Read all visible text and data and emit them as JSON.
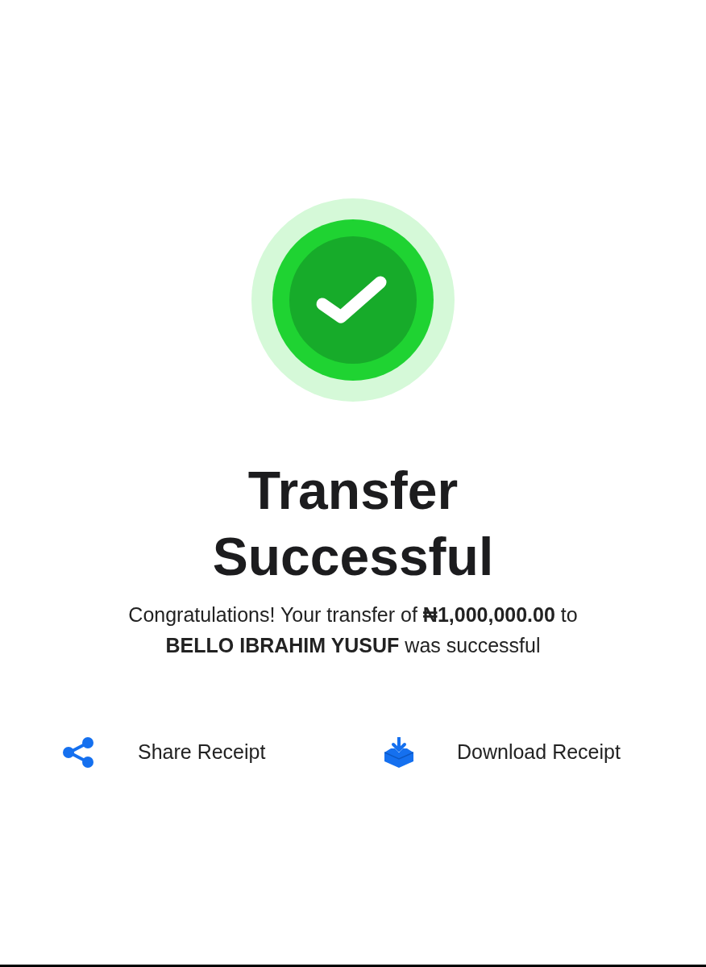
{
  "title": "Transfer Successful",
  "message": "Congratulations! Your transfer of **₦1,000,000.00** to **BELLO IBRAHIM YUSUF** was successful",
  "actions": [
    {
      "kind": "share",
      "label": "Share Receipt"
    },
    {
      "kind": "download",
      "label": "Download Receipt"
    }
  ]
}
